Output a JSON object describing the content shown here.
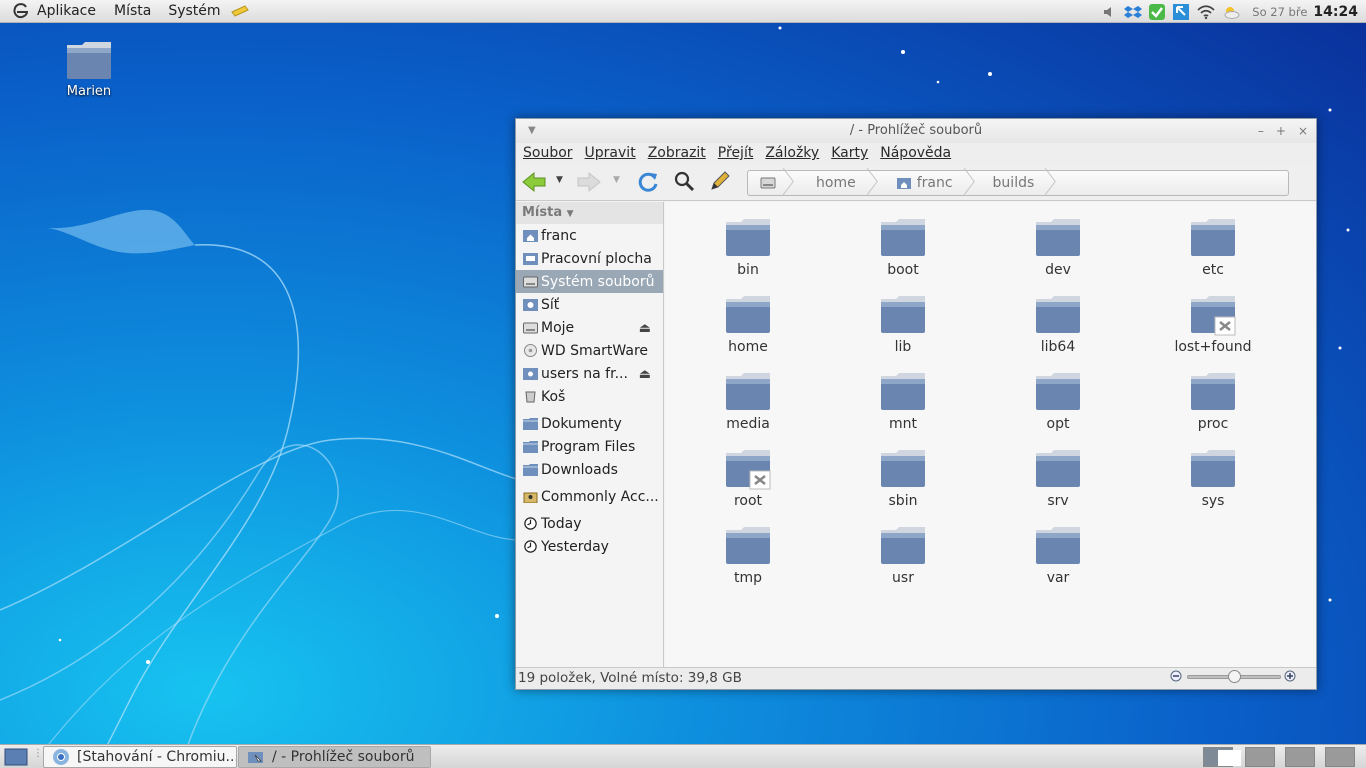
{
  "top_panel": {
    "menus": [
      "Aplikace",
      "Místa",
      "Systém"
    ],
    "clock_date": "So 27 bře",
    "clock_time": "14:24",
    "tray_icons": [
      "volume-icon",
      "dropbox-icon",
      "sync-check-icon",
      "update-icon",
      "wifi-icon",
      "weather-icon"
    ]
  },
  "desktop": {
    "icons": [
      {
        "label": "Marien",
        "icon": "folder-icon"
      }
    ]
  },
  "window": {
    "title": "/ - Prohlížeč souborů",
    "menu": [
      "Soubor",
      "Upravit",
      "Zobrazit",
      "Přejít",
      "Záložky",
      "Karty",
      "Nápověda"
    ],
    "breadcrumbs": [
      "home",
      "franc",
      "builds"
    ],
    "sidebar": {
      "header": "Místa",
      "items": [
        {
          "label": "franc",
          "icon": "home-folder-icon"
        },
        {
          "label": "Pracovní plocha",
          "icon": "desktop-folder-icon"
        },
        {
          "label": "Systém souborů",
          "icon": "drive-icon",
          "selected": true
        },
        {
          "label": "Síť",
          "icon": "network-icon"
        },
        {
          "label": "Moje",
          "icon": "drive-icon",
          "eject": true
        },
        {
          "label": "WD SmartWare",
          "icon": "disc-icon"
        },
        {
          "label": "users na fr...",
          "icon": "network-share-icon",
          "eject": true
        },
        {
          "label": "Koš",
          "icon": "trash-icon"
        },
        {
          "label": "Dokumenty",
          "icon": "folder-icon"
        },
        {
          "label": "Program Files",
          "icon": "folder-icon"
        },
        {
          "label": "Downloads",
          "icon": "folder-icon"
        },
        {
          "label": "Commonly Acc...",
          "icon": "shared-folder-icon"
        },
        {
          "label": "Today",
          "icon": "clock-icon"
        },
        {
          "label": "Yesterday",
          "icon": "clock-icon"
        }
      ]
    },
    "files": [
      {
        "name": "bin"
      },
      {
        "name": "boot"
      },
      {
        "name": "dev"
      },
      {
        "name": "etc"
      },
      {
        "name": "home"
      },
      {
        "name": "lib"
      },
      {
        "name": "lib64"
      },
      {
        "name": "lost+found",
        "locked": true
      },
      {
        "name": "media"
      },
      {
        "name": "mnt"
      },
      {
        "name": "opt"
      },
      {
        "name": "proc"
      },
      {
        "name": "root",
        "locked": true
      },
      {
        "name": "sbin"
      },
      {
        "name": "srv"
      },
      {
        "name": "sys"
      },
      {
        "name": "tmp"
      },
      {
        "name": "usr"
      },
      {
        "name": "var"
      }
    ],
    "status": "19 položek, Volné místo: 39,8 GB",
    "zoom_level": 0.5
  },
  "taskbar": {
    "tasks": [
      {
        "label": "[Stahování - Chromiu...",
        "icon": "chromium-icon",
        "active": false
      },
      {
        "label": "/ - Prohlížeč souborů",
        "icon": "file-manager-icon",
        "active": true
      }
    ],
    "workspaces": 4,
    "active_workspace": 1
  },
  "colors": {
    "accent": "#9aa7b5",
    "folder": "#6f8fbd",
    "desktop": "#0a5fc8"
  }
}
